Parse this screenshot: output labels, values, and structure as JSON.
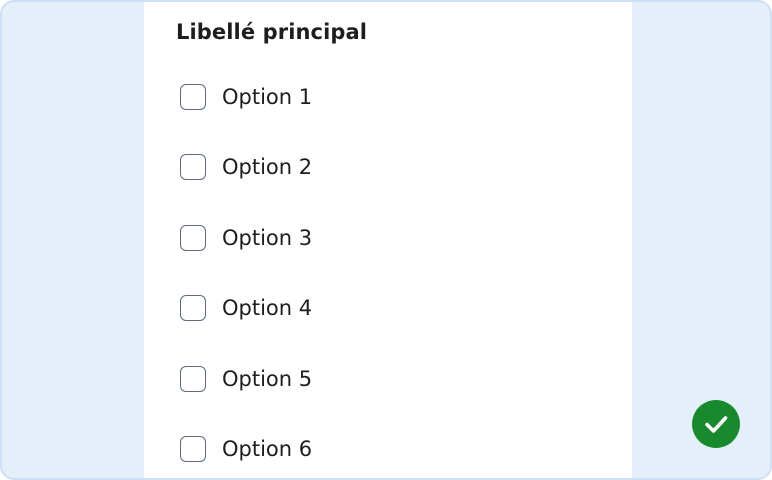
{
  "fieldset": {
    "legend": "Libellé principal",
    "options": [
      {
        "label": "Option 1",
        "checked": false
      },
      {
        "label": "Option 2",
        "checked": false
      },
      {
        "label": "Option 3",
        "checked": false
      },
      {
        "label": "Option 4",
        "checked": false
      },
      {
        "label": "Option 5",
        "checked": false
      },
      {
        "label": "Option 6",
        "checked": false
      }
    ]
  },
  "status": {
    "icon": "check-circle-icon",
    "color": "#18892d"
  },
  "colors": {
    "background": "#e5effa",
    "panel": "#ffffff",
    "checkbox_border": "#5f6a7d",
    "text": "#1e1e1e"
  }
}
